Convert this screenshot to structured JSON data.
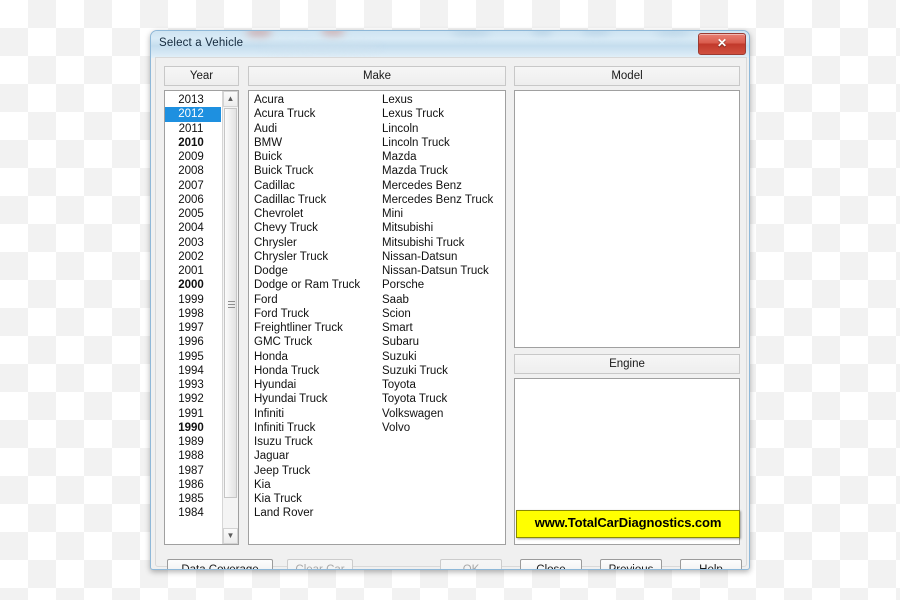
{
  "window": {
    "title": "Select a Vehicle",
    "close_label": "✕",
    "close_icon": "close-icon"
  },
  "columns": {
    "year_header": "Year",
    "make_header": "Make",
    "model_header": "Model",
    "engine_header": "Engine"
  },
  "year_list": {
    "selected": "2012",
    "bold_items": [
      "2010",
      "2000",
      "1990"
    ],
    "items": [
      "2013",
      "2012",
      "2011",
      "2010",
      "2009",
      "2008",
      "2007",
      "2006",
      "2005",
      "2004",
      "2003",
      "2002",
      "2001",
      "2000",
      "1999",
      "1998",
      "1997",
      "1996",
      "1995",
      "1994",
      "1993",
      "1992",
      "1991",
      "1990",
      "1989",
      "1988",
      "1987",
      "1986",
      "1985",
      "1984"
    ]
  },
  "make_list": {
    "column_1": [
      "Acura",
      "Acura Truck",
      "Audi",
      "BMW",
      "Buick",
      "Buick Truck",
      "Cadillac",
      "Cadillac Truck",
      "Chevrolet",
      "Chevy Truck",
      "Chrysler",
      "Chrysler Truck",
      "Dodge",
      "Dodge or Ram Truck",
      "Ford",
      "Ford Truck",
      "Freightliner Truck",
      "GMC Truck",
      "Honda",
      "Honda Truck",
      "Hyundai",
      "Hyundai Truck",
      "Infiniti",
      "Infiniti Truck",
      "Isuzu Truck",
      "Jaguar",
      "Jeep Truck",
      "Kia",
      "Kia Truck",
      "Land Rover"
    ],
    "column_2": [
      "Lexus",
      "Lexus Truck",
      "Lincoln",
      "Lincoln Truck",
      "Mazda",
      "Mazda Truck",
      "Mercedes Benz",
      "Mercedes Benz Truck",
      "Mini",
      "Mitsubishi",
      "Mitsubishi Truck",
      "Nissan-Datsun",
      "Nissan-Datsun Truck",
      "Porsche",
      "Saab",
      "Scion",
      "Smart",
      "Subaru",
      "Suzuki",
      "Suzuki Truck",
      "Toyota",
      "Toyota Truck",
      "Volkswagen",
      "Volvo"
    ]
  },
  "model_list": {
    "items": []
  },
  "engine_list": {
    "items": []
  },
  "banner": {
    "text": "www.TotalCarDiagnostics.com",
    "background_color": "#ffff00",
    "text_color": "#000000"
  },
  "buttons": {
    "data_coverage": "Data Coverage",
    "clear_car": "Clear Car",
    "ok": "OK",
    "close": "Close",
    "previous": "Previous",
    "help": "Help"
  },
  "colors": {
    "selection_blue": "#1e90e0",
    "titlebar_blue": "#cfe4f2",
    "close_red": "#c1392b",
    "dialog_face": "#f0f0f0"
  },
  "scrollbars": {
    "up_arrow": "▲",
    "down_arrow": "▼"
  }
}
